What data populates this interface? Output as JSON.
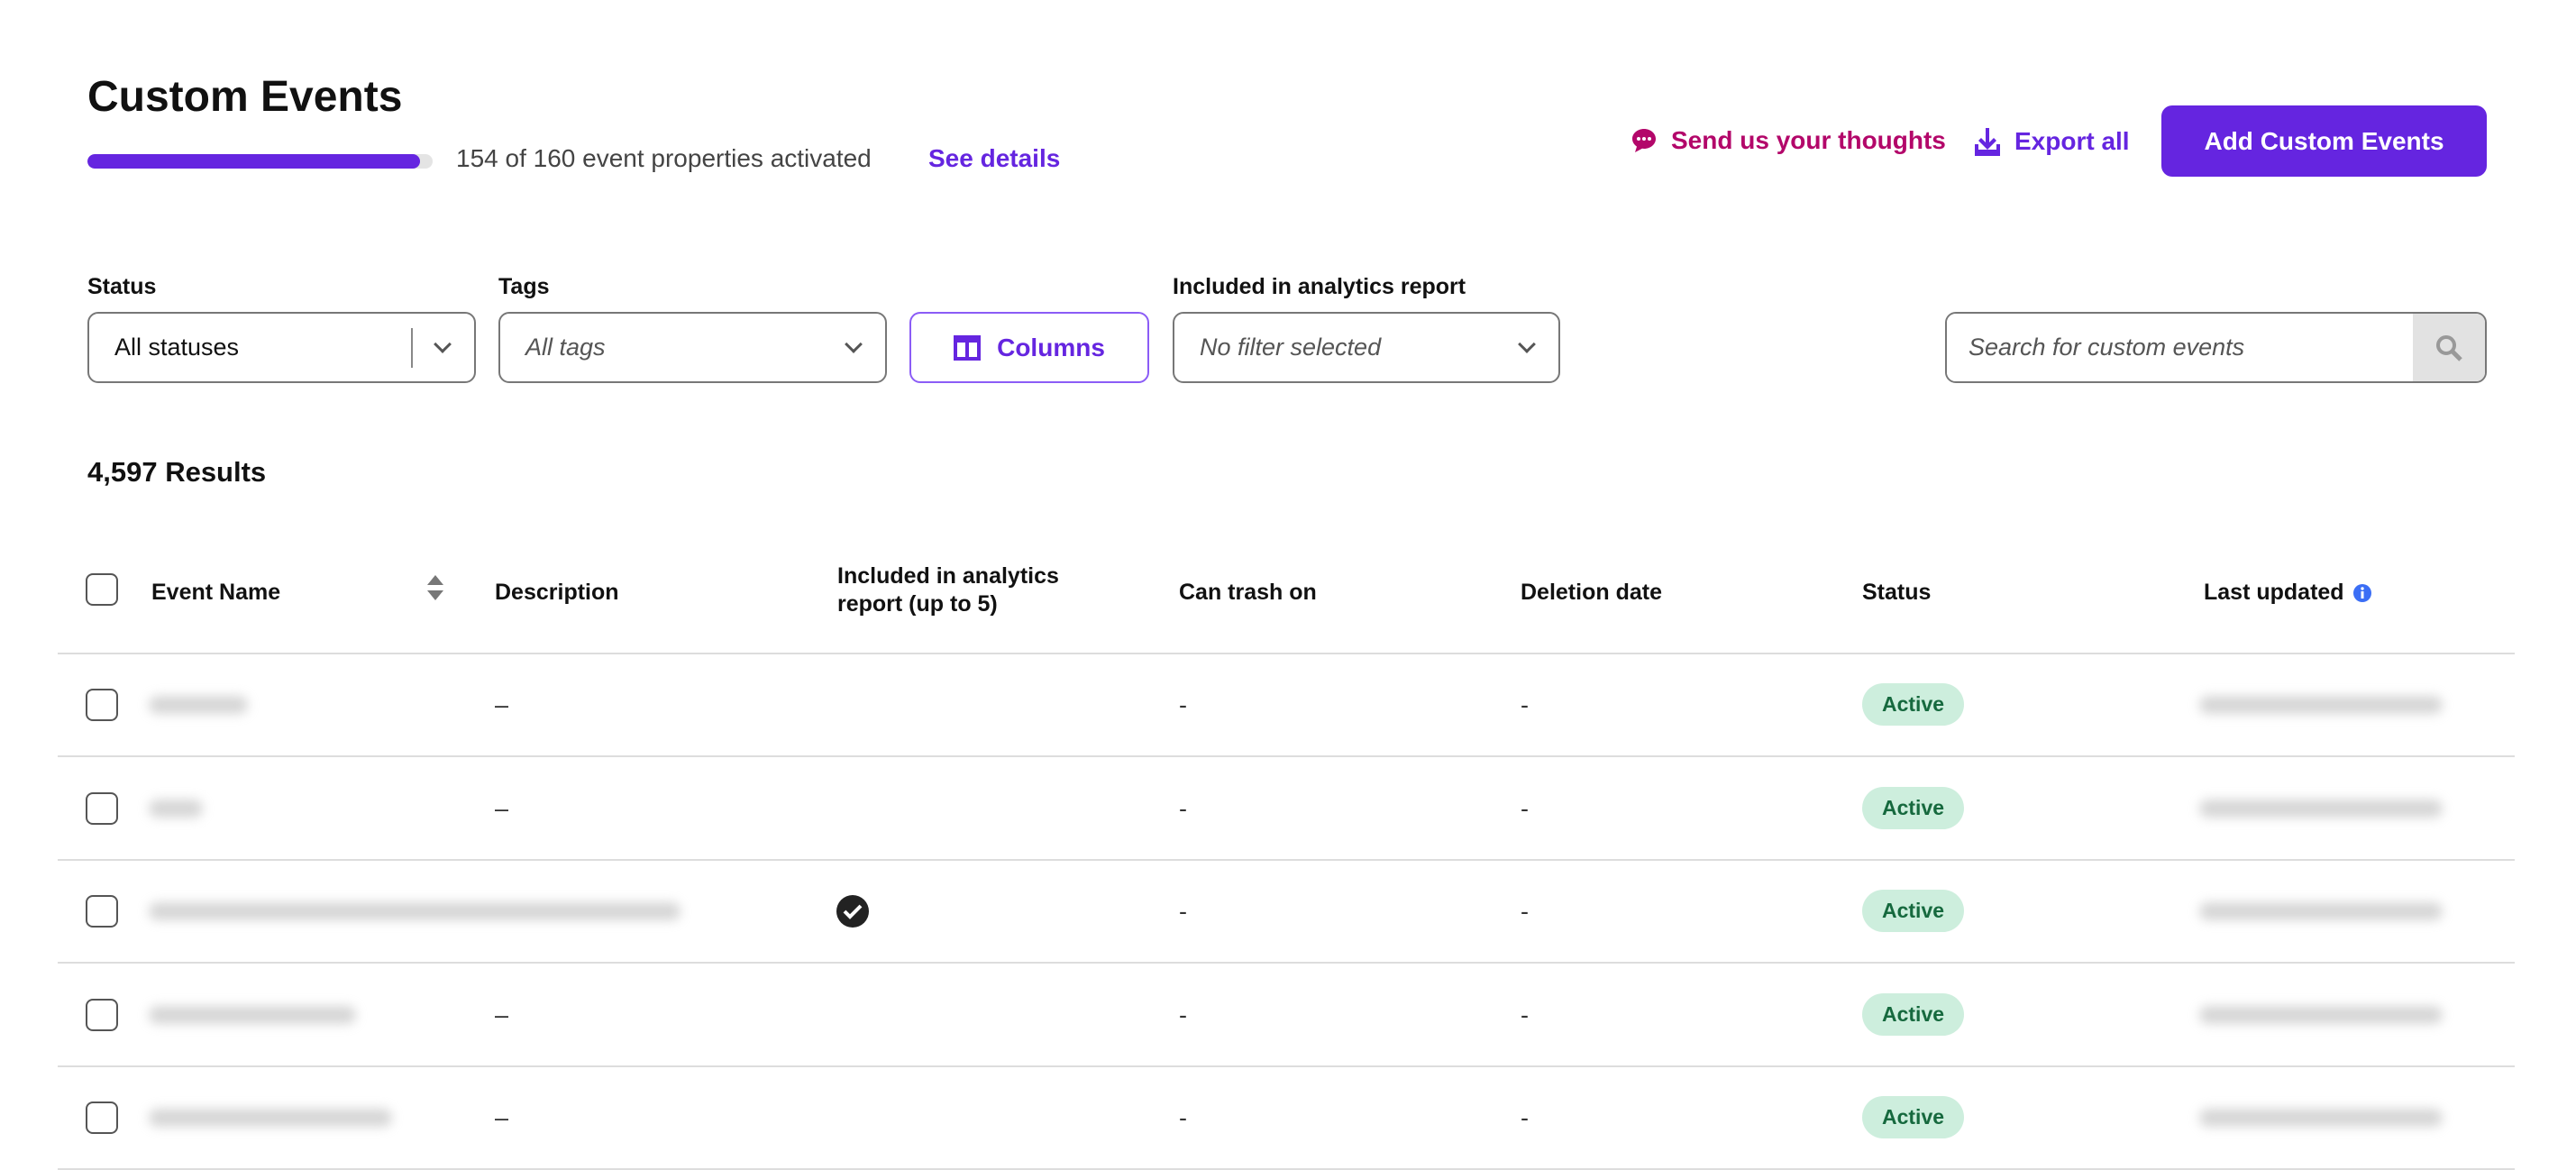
{
  "header": {
    "title": "Custom Events",
    "progress_text": "154 of 160 event properties activated",
    "progress_fraction": 0.9625,
    "see_details": "See details",
    "feedback": "Send us your thoughts",
    "export": "Export all",
    "add": "Add Custom Events"
  },
  "filters": {
    "status_label": "Status",
    "status_value": "All statuses",
    "tags_label": "Tags",
    "tags_value": "All tags",
    "columns": "Columns",
    "analytics_label": "Included in analytics report",
    "analytics_value": "No filter selected",
    "search_placeholder": "Search for custom events"
  },
  "results": "4,597 Results",
  "table": {
    "headers": {
      "event_name": "Event Name",
      "description": "Description",
      "included": "Included in analytics report (up to 5)",
      "can_trash": "Can trash on",
      "deletion": "Deletion date",
      "status": "Status",
      "last_updated": "Last updated"
    },
    "rows": [
      {
        "description": "–",
        "included": false,
        "can_trash": "-",
        "deletion": "-",
        "status": "Active"
      },
      {
        "description": "–",
        "included": false,
        "can_trash": "-",
        "deletion": "-",
        "status": "Active"
      },
      {
        "description": "",
        "included": true,
        "can_trash": "-",
        "deletion": "-",
        "status": "Active"
      },
      {
        "description": "–",
        "included": false,
        "can_trash": "-",
        "deletion": "-",
        "status": "Active"
      },
      {
        "description": "–",
        "included": false,
        "can_trash": "-",
        "deletion": "-",
        "status": "Active"
      }
    ]
  },
  "colors": {
    "accent": "#6525e0",
    "feedback": "#b3076a",
    "badge_bg": "#cdeedd",
    "badge_text": "#16693e"
  }
}
